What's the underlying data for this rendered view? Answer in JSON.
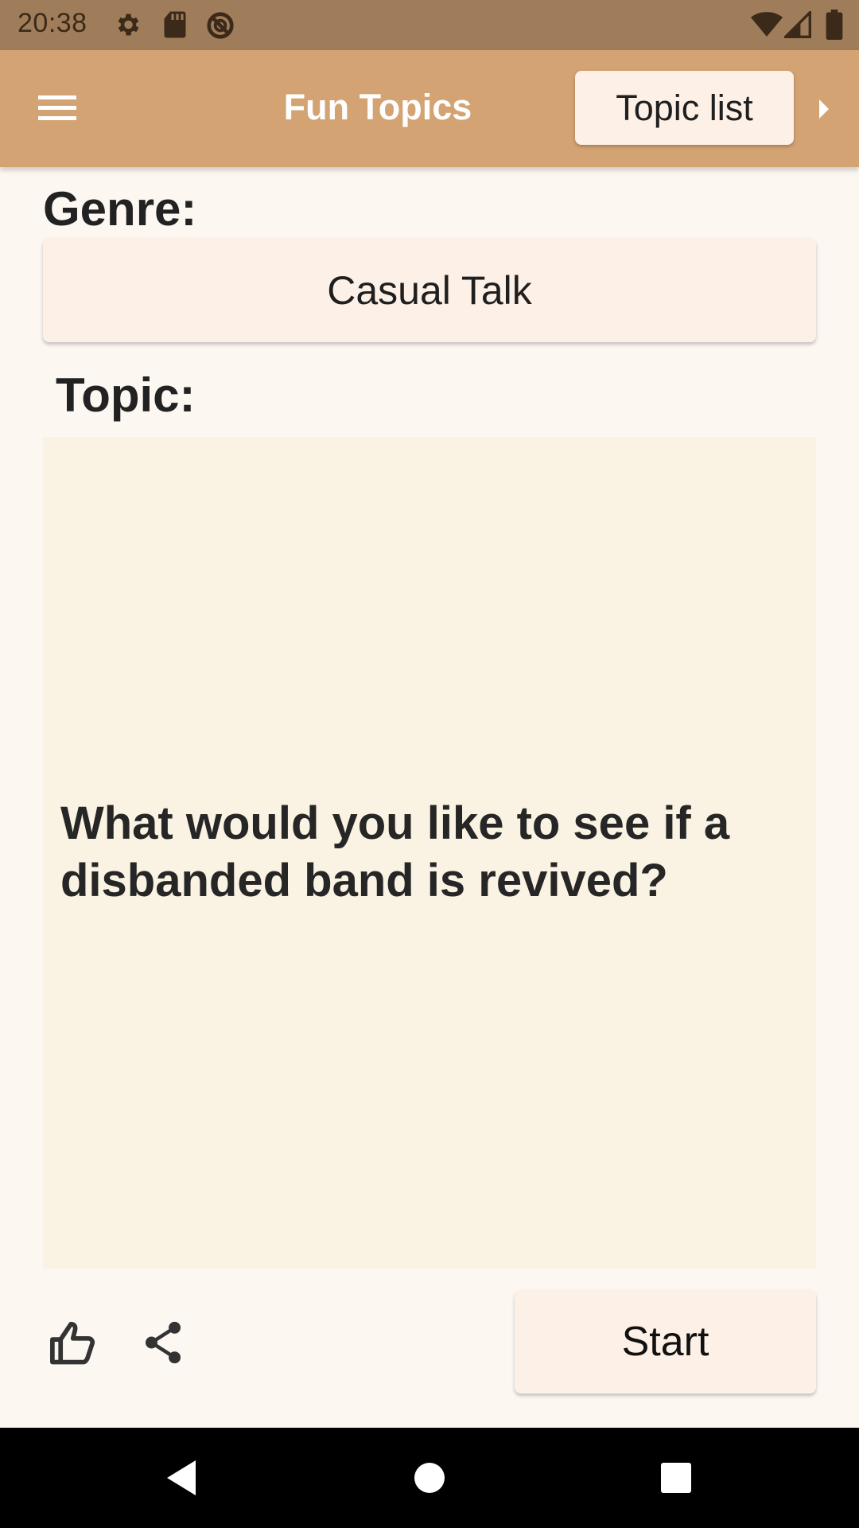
{
  "status_bar": {
    "time": "20:38",
    "left_icons": [
      "settings-icon",
      "sd-card-icon",
      "data-saver-icon"
    ],
    "right_icons": [
      "wifi-icon",
      "cell-signal-icon",
      "battery-icon"
    ]
  },
  "app_bar": {
    "title": "Fun Topics",
    "menu_icon": "hamburger-menu-icon",
    "topic_list_label": "Topic list",
    "overflow_icon": "triangle-right-icon"
  },
  "genre": {
    "label": "Genre:",
    "value": "Casual Talk"
  },
  "topic": {
    "label": "Topic:",
    "text": "What would you like to see if a disbanded band is revived?"
  },
  "actions": {
    "like_icon": "thumbs-up-icon",
    "share_icon": "share-icon",
    "start_label": "Start"
  },
  "nav_bar": {
    "icons": [
      "back-icon",
      "home-icon",
      "recents-icon"
    ]
  },
  "colors": {
    "status_bar": "#a07d5a",
    "app_bar": "#d4a373",
    "button_bg": "#fdf0e6",
    "topic_bg": "#faf2e2",
    "page_bg": "#fdf7f2"
  }
}
